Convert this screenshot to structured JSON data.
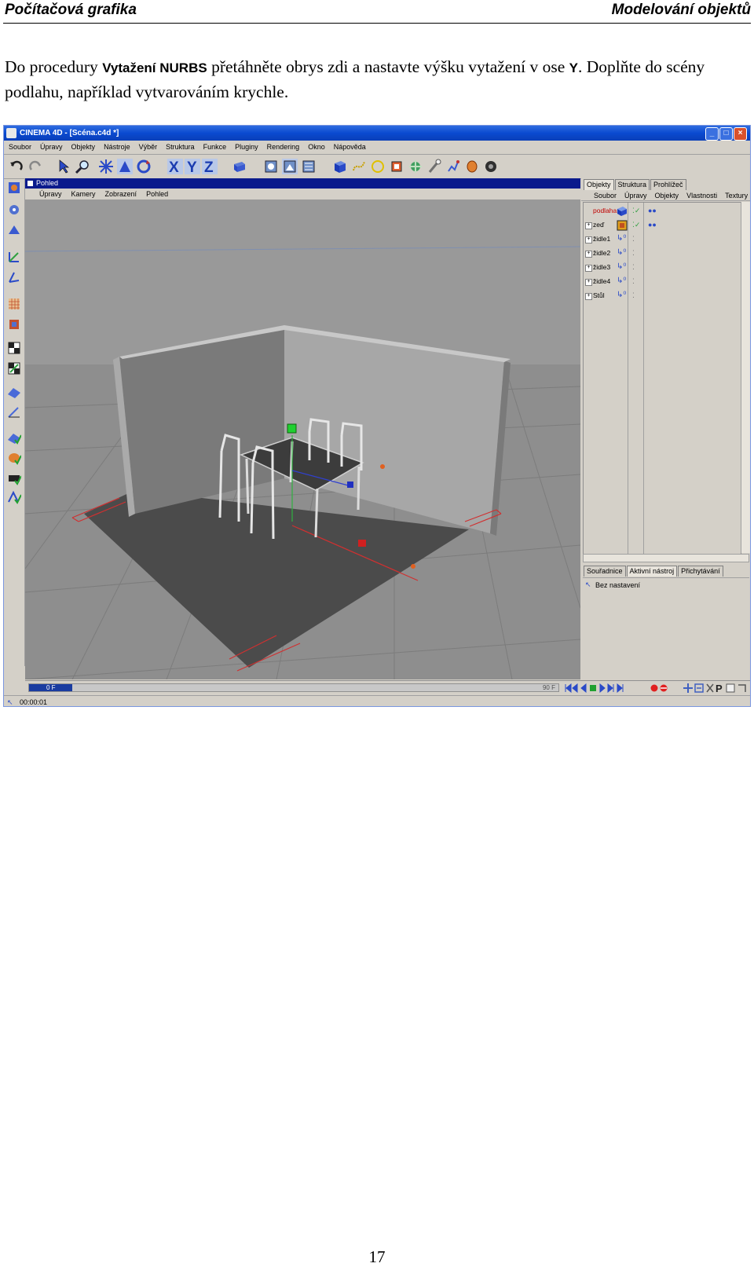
{
  "header": {
    "left": "Počítačová grafika",
    "right": "Modelování objektů"
  },
  "paragraph": {
    "part1": "Do procedury ",
    "term1": "Vytažení NURBS",
    "part2": " přetáhněte obrys zdi a nastavte výšku vytažení v ose ",
    "term2": "Y",
    "part3": ". Doplňte do scény podlahu, například vytvarováním krychle."
  },
  "screenshot": {
    "window_title": "CINEMA 4D - [Scéna.c4d *]",
    "menu": [
      "Soubor",
      "Úpravy",
      "Objekty",
      "Nástroje",
      "Výběr",
      "Struktura",
      "Funkce",
      "Pluginy",
      "Rendering",
      "Okno",
      "Nápověda"
    ],
    "viewport": {
      "title": "Pohled",
      "menu": [
        "Úpravy",
        "Kamery",
        "Zobrazení",
        "Pohled"
      ]
    },
    "object_manager": {
      "tabs": [
        "Objekty",
        "Struktura",
        "Prohlížeč"
      ],
      "menu": [
        "Soubor",
        "Úpravy",
        "Objekty",
        "Vlastnosti",
        "Textury"
      ],
      "objects": [
        {
          "name": "podlaha",
          "selected": true
        },
        {
          "name": "zeď"
        },
        {
          "name": "židle1"
        },
        {
          "name": "židle2"
        },
        {
          "name": "židle3"
        },
        {
          "name": "židle4"
        },
        {
          "name": "Stůl"
        }
      ]
    },
    "attributes": {
      "tabs": [
        "Souřadnice",
        "Aktivní nástroj",
        "Přichytávání"
      ],
      "content": "Bez nastavení"
    },
    "timeline": {
      "current_frame": "0 F",
      "end_frame": "90 F"
    },
    "status": "00:00:01",
    "colors": {
      "titlebar": "#0a4ad0",
      "viewport_title": "#0a1a8c",
      "viewport_bg": "#8d8d8d",
      "floor": "#4b4b4b"
    }
  },
  "page_number": "17"
}
